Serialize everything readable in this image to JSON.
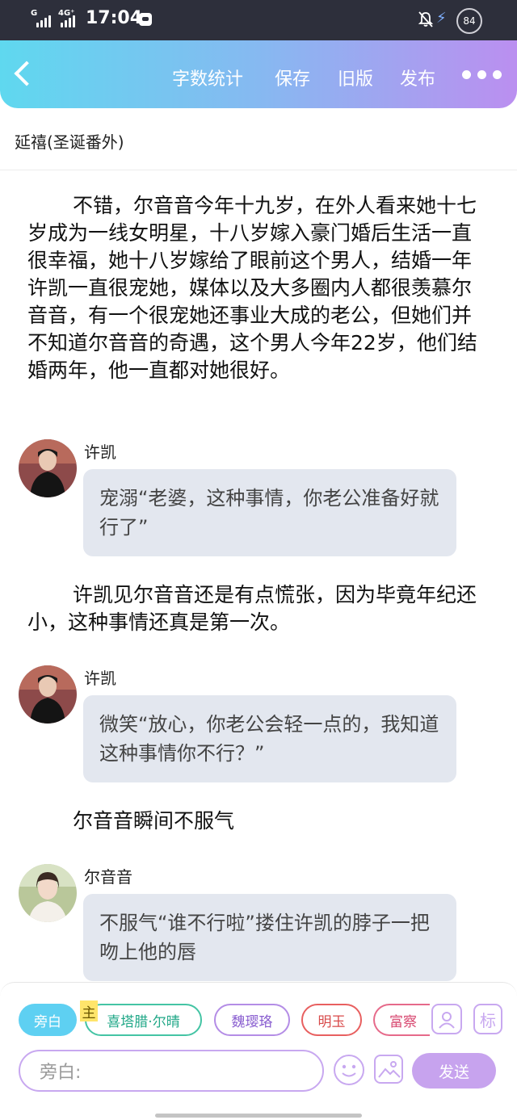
{
  "status_bar": {
    "signal_1_label": "G",
    "signal_2_label": "4G⁺",
    "time": "17:04",
    "battery": "84",
    "charging_icon": "⚡"
  },
  "header": {
    "back_icon": "back-chevron",
    "buttons": [
      "字数统计",
      "保存",
      "旧版",
      "发布"
    ],
    "more_icon": "more-dots"
  },
  "chapter_title": "延禧(圣诞番外)",
  "story": {
    "paragraph_1": "不错，尔音音今年十九岁，在外人看来她十七岁成为一线女明星，十八岁嫁入豪门婚后生活一直很幸福，她十八岁嫁给了眼前这个男人，结婚一年许凯一直很宠她，媒体以及大多圈内人都很羡慕尔音音，有一个很宠她还事业大成的老公，但她们并不知道尔音音的奇遇，这个男人今年22岁，他们结婚两年，他一直都对她很好。",
    "message_1": {
      "speaker": "许凯",
      "text": "宠溺“老婆，这种事情，你老公准备好就行了”"
    },
    "paragraph_2": "许凯见尔音音还是有点慌张，因为毕竟年纪还小，这种事情还真是第一次。",
    "message_2": {
      "speaker": "许凯",
      "text": "微笑“放心，你老公会轻一点的，我知道这种事情你不行？”"
    },
    "paragraph_3": "尔音音瞬间不服气",
    "message_3": {
      "speaker": "尔音音",
      "text": "不服气“谁不行啦”搂住许凯的脖子一把吻上他的唇"
    }
  },
  "composer": {
    "roles": {
      "narrator": "旁白",
      "main_tag": "主",
      "main": "喜塔腊·尔晴",
      "role_2": "魏璎珞",
      "role_3": "明玉",
      "role_4": "富察"
    },
    "tools": {
      "character_icon": "person-card-icon",
      "tag_label": "标"
    },
    "input_placeholder": "旁白:",
    "send_label": "发送"
  },
  "colors": {
    "header_gradient_start": "#5fd8ef",
    "header_gradient_end": "#bb8ff0",
    "narrator_chip": "#5ed0f2",
    "accent_purple": "#c7a3ee",
    "bubble_bg": "#e3e7ef"
  }
}
